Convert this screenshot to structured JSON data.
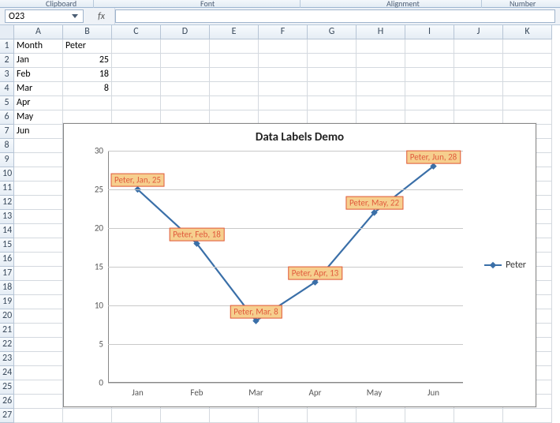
{
  "ribbon": {
    "group_clipboard": "Clipboard",
    "group_font": "Font",
    "group_alignment": "Alignment",
    "group_number": "Number"
  },
  "formula_bar": {
    "namebox_value": "O23",
    "fx_label": "fx",
    "formula_value": ""
  },
  "columns": [
    "A",
    "B",
    "C",
    "D",
    "E",
    "F",
    "G",
    "H",
    "I",
    "J",
    "K"
  ],
  "sheet": {
    "A1": "Month",
    "B1": "Peter",
    "A2": "Jan",
    "B2": "25",
    "A3": "Feb",
    "B3": "18",
    "A4": "Mar",
    "B4": "8",
    "A5": "Apr",
    "B5": "",
    "A6": "May",
    "B6": "",
    "A7": "Jun",
    "B7": ""
  },
  "chart_data": {
    "type": "line",
    "title": "Data Labels Demo",
    "categories": [
      "Jan",
      "Feb",
      "Mar",
      "Apr",
      "May",
      "Jun"
    ],
    "series": [
      {
        "name": "Peter",
        "values": [
          25,
          18,
          8,
          13,
          22,
          28
        ]
      }
    ],
    "y_ticks": [
      0,
      5,
      10,
      15,
      20,
      25,
      30
    ],
    "ylim": [
      0,
      30
    ],
    "data_labels": [
      "Peter, Jan, 25",
      "Peter, Feb, 18",
      "Peter, Mar, 8",
      "Peter, Apr, 13",
      "Peter, May, 22",
      "Peter, Jun, 28"
    ],
    "legend_position": "right",
    "xlabel": "",
    "ylabel": "",
    "line_color": "#3a6fa8",
    "label_fill": "#f6cf8e",
    "label_text_color": "#e05a3c"
  }
}
